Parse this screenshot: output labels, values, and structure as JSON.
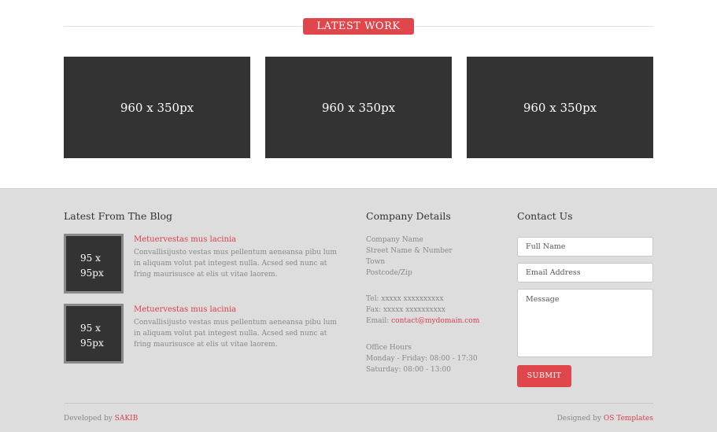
{
  "latest_work": {
    "heading": "LATEST WORK",
    "items": [
      "960 x 350px",
      "960 x 350px",
      "960 x 350px"
    ]
  },
  "blog": {
    "title": "Latest From The Blog",
    "posts": [
      {
        "thumb_line1": "95 x",
        "thumb_line2": "95px",
        "title": "Metuervestas mus lacinia",
        "text": "Convallisijusto vestas mus pellentum aeneansa pibu lum in aliquam volut pat integest nulla. Acsed sed nunc at fring maurisusce at elis ut vitae laorem."
      },
      {
        "thumb_line1": "95 x",
        "thumb_line2": "95px",
        "title": "Metuervestas mus lacinia",
        "text": "Convallisijusto vestas mus pellentum aeneansa pibu lum in aliquam volut pat integest nulla. Acsed sed nunc at fring maurisusce at elis ut vitae laorem."
      }
    ]
  },
  "company": {
    "title": "Company Details",
    "address": [
      "Company Name",
      "Street Name & Number",
      "Town",
      "Postcode/Zip"
    ],
    "tel": "Tel: xxxxx xxxxxxxxxx",
    "fax": "Fax: xxxxx xxxxxxxxxx",
    "email_label": "Email: ",
    "email": "contact@mydomain.com",
    "hours_title": "Office Hours",
    "hours_weekday": "Monday - Friday: 08:00 - 17:30",
    "hours_saturday": "Saturday: 08:00 - 13:00"
  },
  "contact": {
    "title": "Contact Us",
    "name_placeholder": "Full Name",
    "email_placeholder": "Email Address",
    "message_placeholder": "Message",
    "submit": "SUBMIT"
  },
  "footer": {
    "developed_prefix": "Developed by ",
    "developer": "SAKIB",
    "designed_prefix": "Designed by ",
    "designer": "OS Templates"
  },
  "colors": {
    "accent": "#e0474c",
    "dark_tile": "#333333",
    "footer_bg": "#dddddd"
  }
}
